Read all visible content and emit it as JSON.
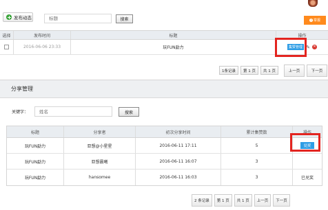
{
  "toolbar": {
    "publish_label": "发布动态",
    "title_placeholder": "标题",
    "search_label": "搜索",
    "report_label": "举报"
  },
  "main": {
    "headers": [
      "选择",
      "发布时间",
      "标题",
      "操作"
    ],
    "row": {
      "time": "2016-06-06 23:33",
      "title": "玩FUN勐力",
      "manage_label": "集赞管理"
    },
    "pager": {
      "records": "1条记录",
      "page": "第 1 页",
      "total": "共 1 页",
      "prev": "上一页",
      "next": "下一页"
    }
  },
  "modal": {
    "title": "分享管理",
    "keyword_label": "关键字：",
    "keyword_placeholder": "姓名",
    "search_label": "搜索",
    "headers": [
      "标题",
      "分享者",
      "初次分享时间",
      "累计集赞数",
      "操作"
    ],
    "rows": [
      {
        "title": "玩FUN勐力",
        "sharer": "亚想@小星星",
        "time": "2016-06-11 17:11",
        "count": "5",
        "action": "兑奖"
      },
      {
        "title": "玩FUN勐力",
        "sharer": "亚想晨曦",
        "time": "2016-06-11 16:07",
        "count": "3",
        "action": ""
      },
      {
        "title": "玩FUN勐力",
        "sharer": "hansomee",
        "time": "2016-06-11 16:03",
        "count": "3",
        "action": "已兑奖"
      }
    ],
    "pager": {
      "records": "2 条记录",
      "page": "第 1 页",
      "total": "共 1 页",
      "prev": "上一页",
      "next": "下一页"
    }
  },
  "colors": {
    "accent": "#2e9de5",
    "highlight": "#e3241f",
    "report": "#ff8a1d"
  }
}
